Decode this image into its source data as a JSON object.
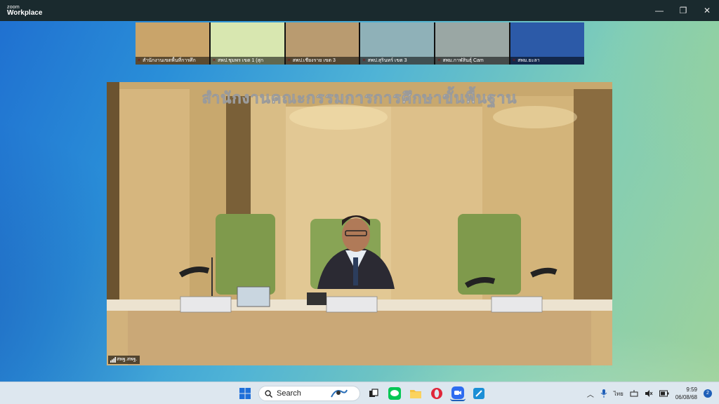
{
  "app": {
    "brand_top": "zoom",
    "brand_bottom": "Workplace"
  },
  "window_controls": {
    "minimize": "—",
    "restore": "❐",
    "close": "✕"
  },
  "gallery": [
    {
      "label": "สำนักงานเขตพื้นที่การศึก",
      "bg": "#c9a46a"
    },
    {
      "label": "สพป.ชุมพร เขต 1 (สุก",
      "bg": "#d8e7b0"
    },
    {
      "label": "สพป.เชียงราย เขต 3",
      "bg": "#b99b70"
    },
    {
      "label": "สพป.สุรินทร์ เขต 3",
      "bg": "#8fb1b8"
    },
    {
      "label": "สพม.กาฬสินธุ์ Cam",
      "bg": "#9aa7a4"
    },
    {
      "label": "สพม.ยะลา",
      "bg": "#2c5aa8"
    }
  ],
  "main_video": {
    "speaker_label": "สพฐ.สพฐ.",
    "wall_text": "สำนักงานคณะกรรมการการศึกษาขั้นพื้นฐาน"
  },
  "taskbar": {
    "search_placeholder": "Search",
    "language": "ไทย",
    "time": "9:59",
    "date": "06/08/68",
    "notification_count": "2"
  },
  "colors": {
    "titlebar": "#1a2a2e",
    "taskbar": "#dde7ef",
    "accent": "#1e5fb8"
  }
}
